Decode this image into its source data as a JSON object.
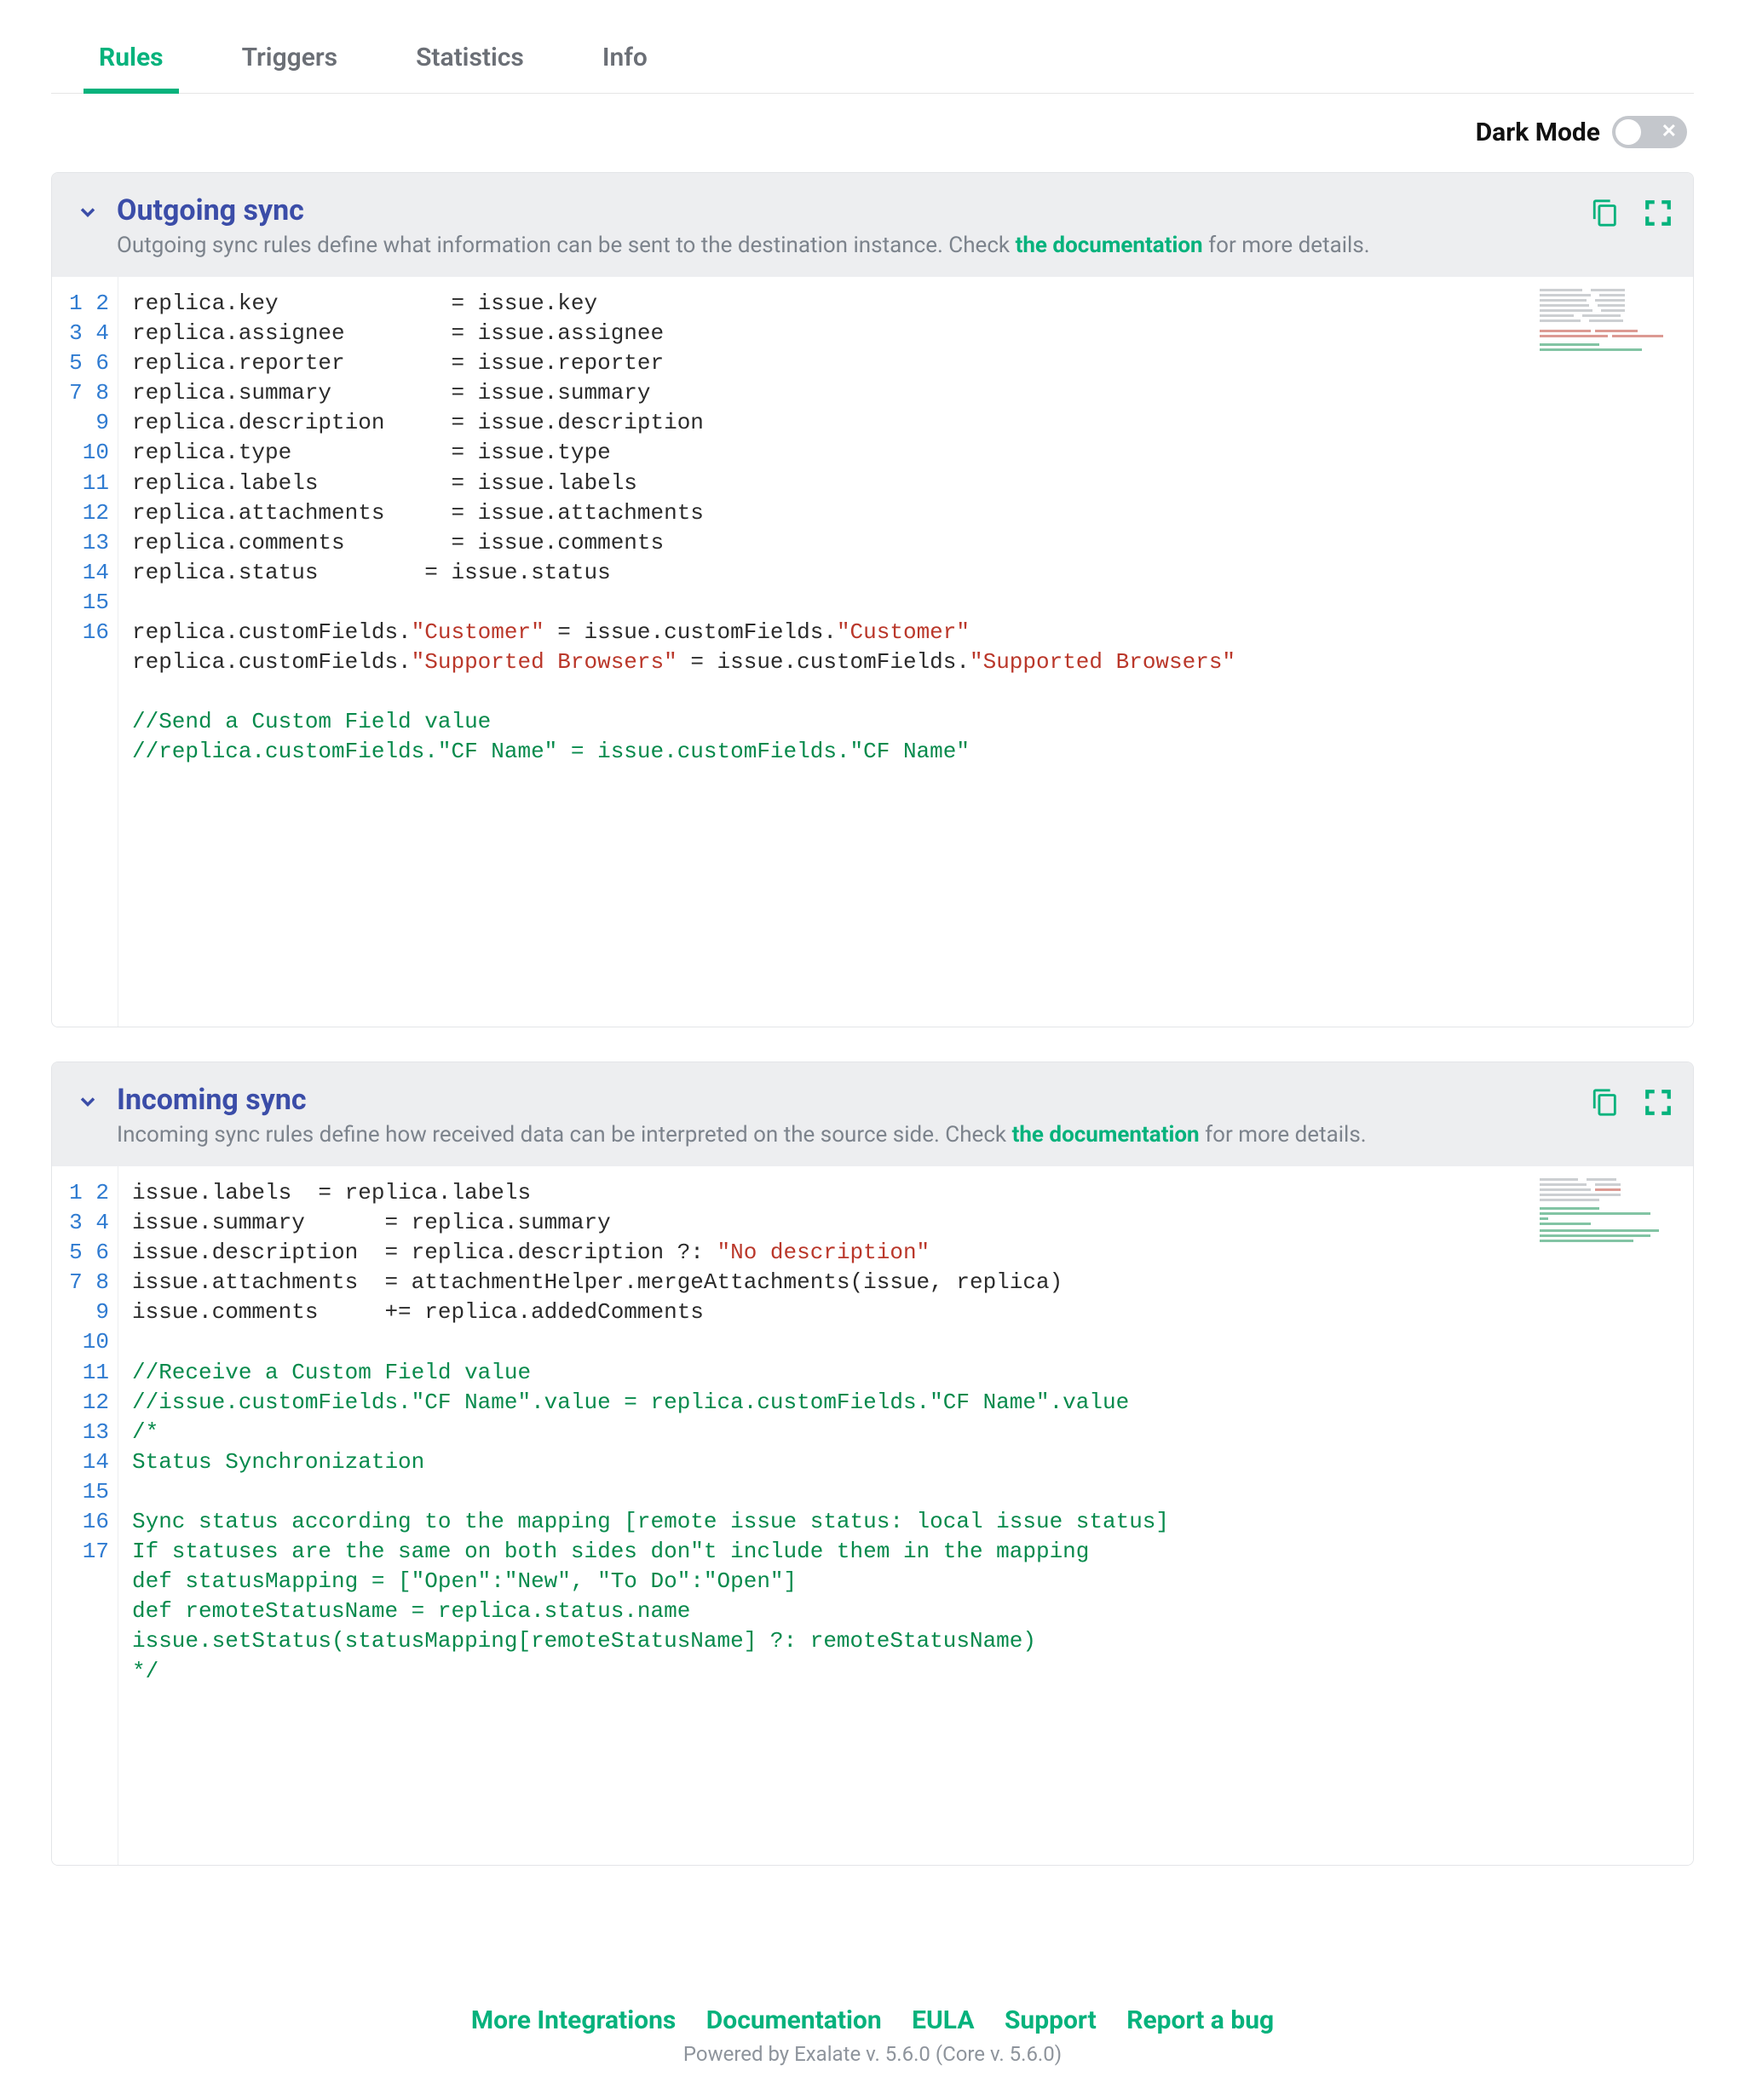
{
  "tabs": {
    "rules": "Rules",
    "triggers": "Triggers",
    "statistics": "Statistics",
    "info": "Info"
  },
  "dark_mode": {
    "label": "Dark Mode"
  },
  "doc_link_label": "the documentation",
  "outgoing": {
    "title": "Outgoing sync",
    "desc_pre": "Outgoing sync rules define what information can be sent to the destination instance. Check ",
    "desc_post": " for more details."
  },
  "incoming": {
    "title": "Incoming sync",
    "desc_pre": "Incoming sync rules define how received data can be interpreted on the source side. Check ",
    "desc_post": " for more details."
  },
  "footer": {
    "more_integrations": "More Integrations",
    "documentation": "Documentation",
    "eula": "EULA",
    "support": "Support",
    "report_bug": "Report a bug",
    "powered": "Powered by Exalate v. 5.6.0 (Core v. 5.6.0)"
  },
  "outgoing_code": {
    "l1": "replica.key             = issue.key",
    "l2": "replica.assignee        = issue.assignee",
    "l3": "replica.reporter        = issue.reporter",
    "l4": "replica.summary         = issue.summary",
    "l5": "replica.description     = issue.description",
    "l6": "replica.type            = issue.type",
    "l7": "replica.labels          = issue.labels",
    "l8": "replica.attachments     = issue.attachments",
    "l9": "replica.comments        = issue.comments",
    "l10": "replica.status        = issue.status",
    "l11": "",
    "l12a": "replica.customFields.",
    "l12b": "\"Customer\"",
    "l12c": " = issue.customFields.",
    "l12d": "\"Customer\"",
    "l13a": "replica.customFields.",
    "l13b": "\"Supported Browsers\"",
    "l13c": " = issue.customFields.",
    "l13d": "\"Supported Browsers\"",
    "l14": "",
    "l15": "//Send a Custom Field value",
    "l16": "//replica.customFields.\"CF Name\" = issue.customFields.\"CF Name\""
  },
  "incoming_code": {
    "l1": "issue.labels  = replica.labels",
    "l2": "issue.summary      = replica.summary",
    "l3a": "issue.description  = replica.description ?: ",
    "l3b": "\"No description\"",
    "l4": "issue.attachments  = attachmentHelper.mergeAttachments(issue, replica)",
    "l5": "issue.comments     += replica.addedComments",
    "l6": "",
    "l7": "//Receive a Custom Field value",
    "l8": "//issue.customFields.\"CF Name\".value = replica.customFields.\"CF Name\".value",
    "l9": "/*",
    "l10": "Status Synchronization",
    "l11": "",
    "l12": "Sync status according to the mapping [remote issue status: local issue status]",
    "l13": "If statuses are the same on both sides don\"t include them in the mapping",
    "l14": "def statusMapping = [\"Open\":\"New\", \"To Do\":\"Open\"]",
    "l15": "def remoteStatusName = replica.status.name",
    "l16": "issue.setStatus(statusMapping[remoteStatusName] ?: remoteStatusName)",
    "l17": "*/"
  },
  "line_nums_16": [
    "1",
    "2",
    "3",
    "4",
    "5",
    "6",
    "7",
    "8",
    "9",
    "10",
    "11",
    "12",
    "13",
    "14",
    "15",
    "16"
  ],
  "line_nums_17": [
    "1",
    "2",
    "3",
    "4",
    "5",
    "6",
    "7",
    "8",
    "9",
    "10",
    "11",
    "12",
    "13",
    "14",
    "15",
    "16",
    "17"
  ]
}
